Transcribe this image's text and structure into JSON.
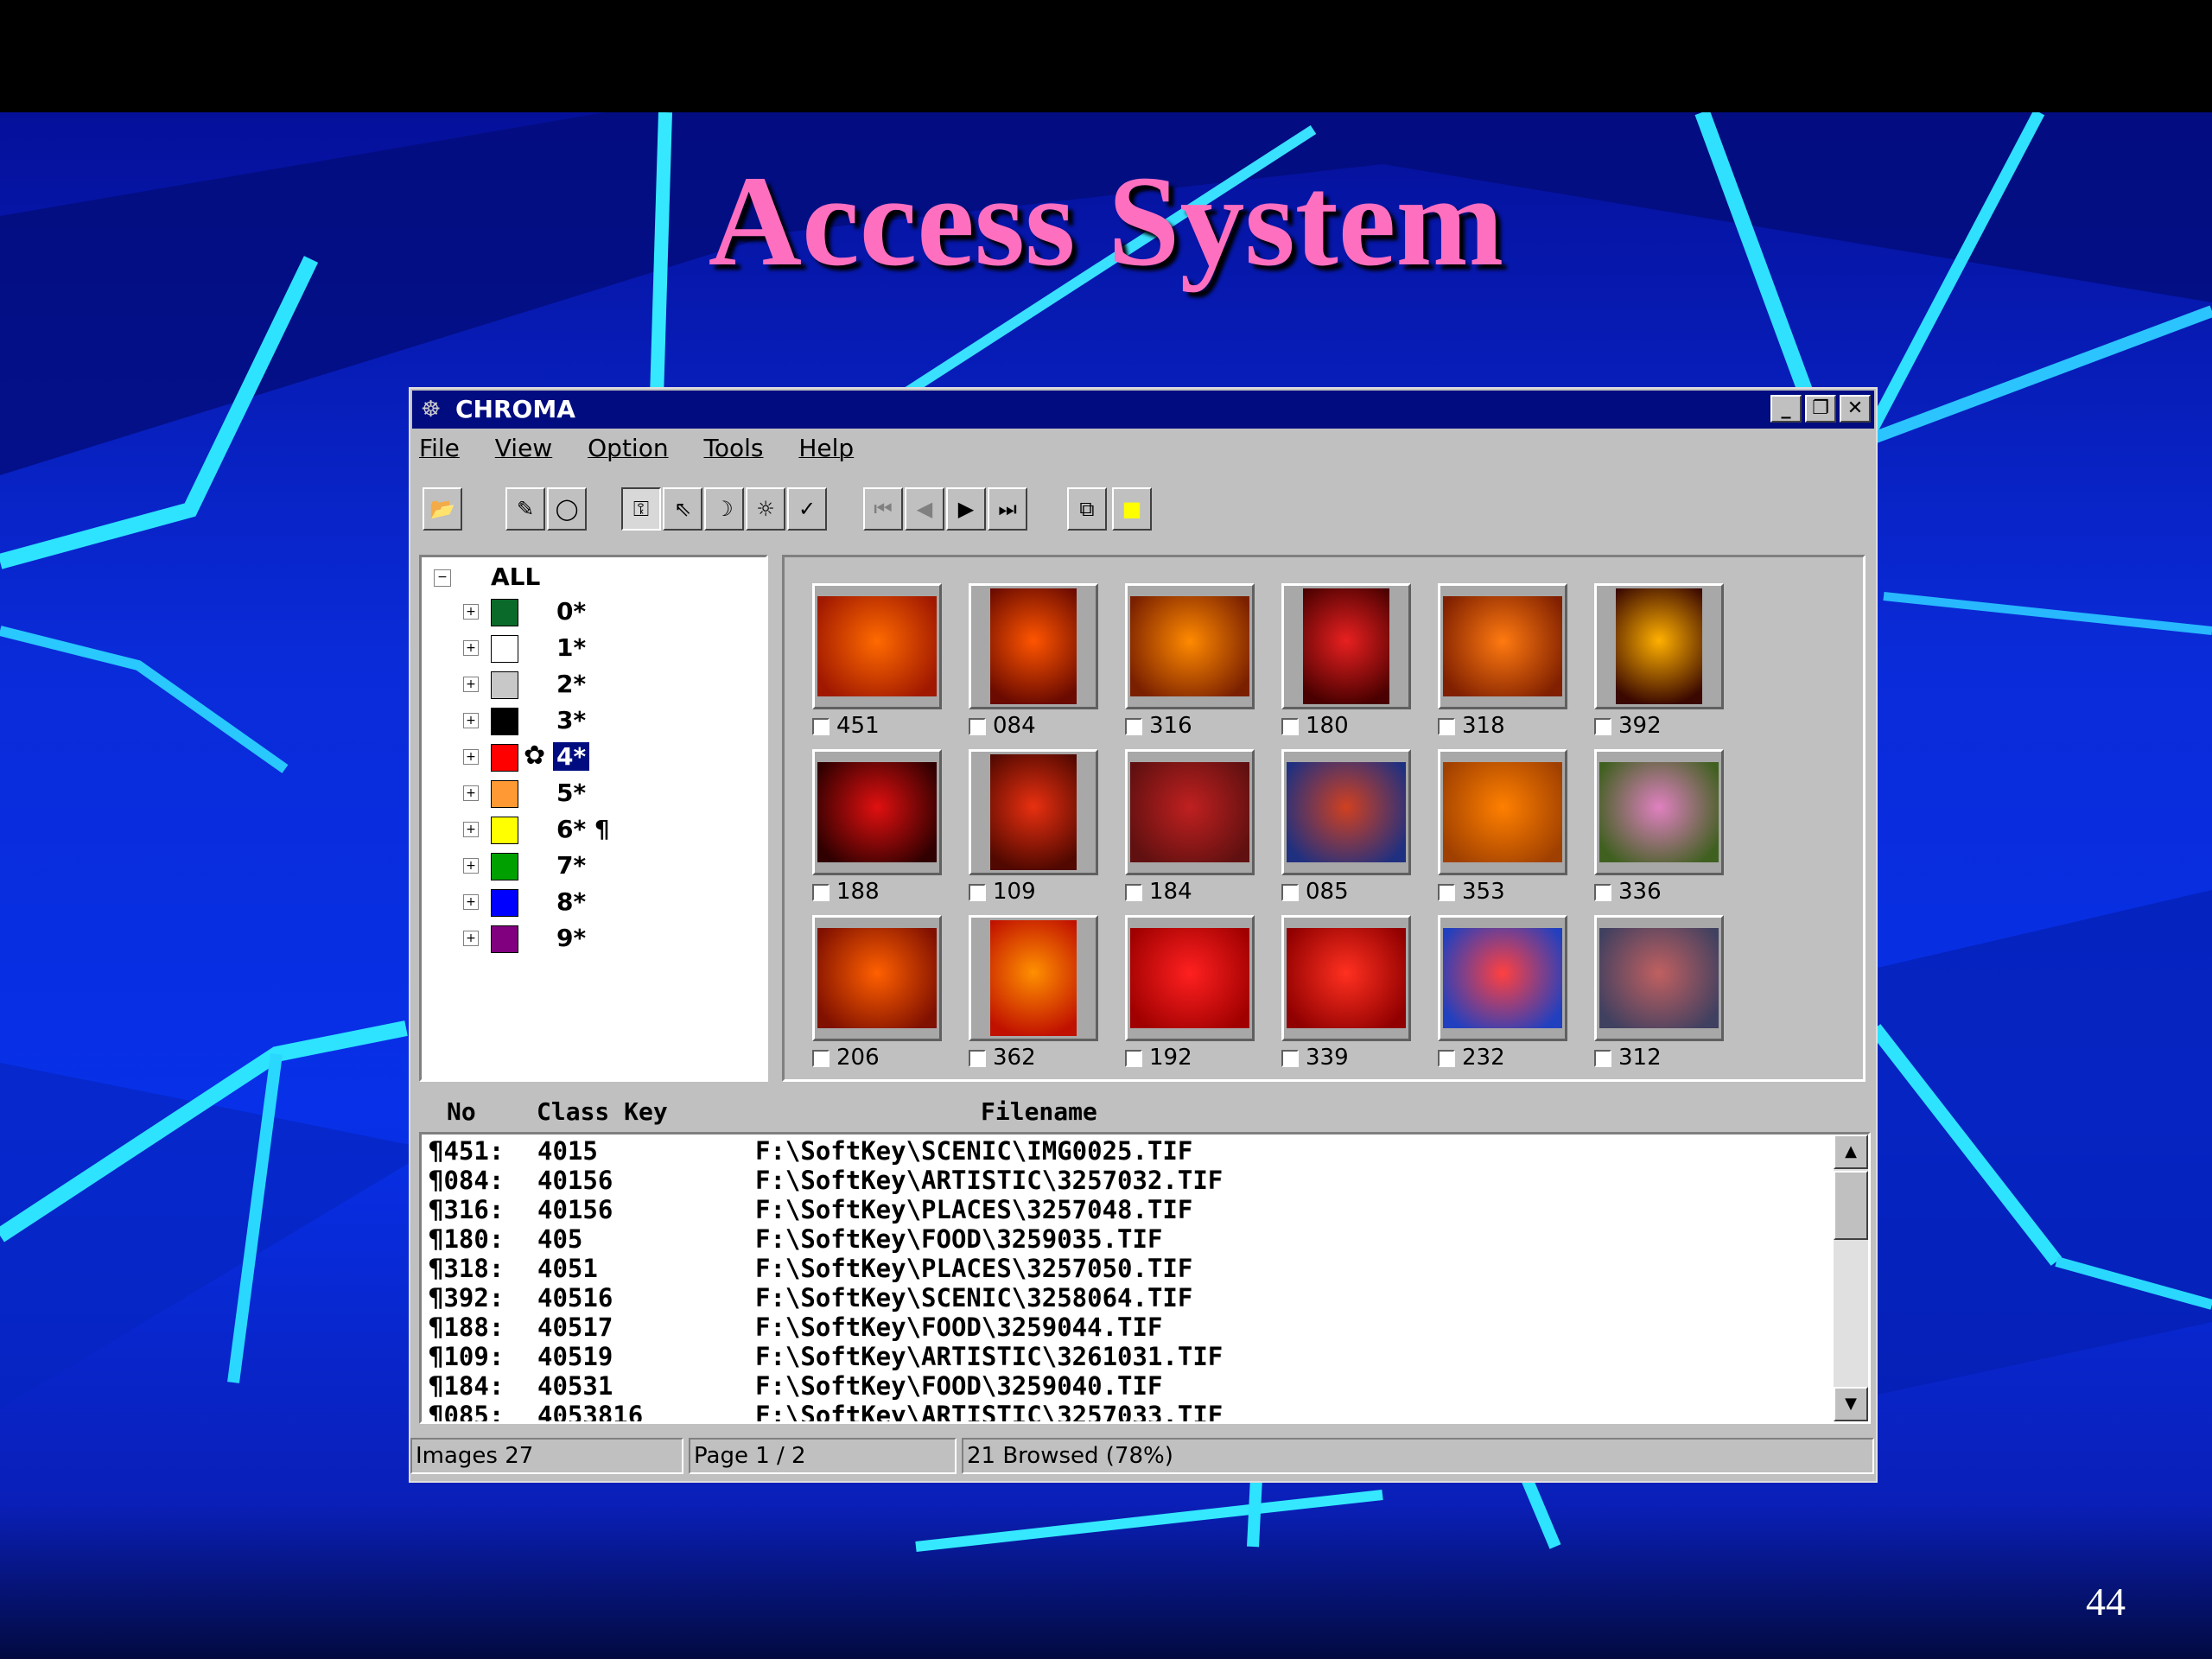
{
  "slide": {
    "title": "Access System",
    "page_number": "44",
    "colors": {
      "title": "#ff6fc0",
      "background": "#0a2bd8",
      "streaks": "#2ee3ff"
    }
  },
  "window": {
    "title": "CHROMA",
    "app_icon": "chroma-app-icon",
    "controls": {
      "minimize": "_",
      "restore": "❐",
      "close": "✕"
    },
    "titlebar_color": "#000c80"
  },
  "menu": [
    {
      "label": "File"
    },
    {
      "label": "View"
    },
    {
      "label": "Option"
    },
    {
      "label": "Tools"
    },
    {
      "label": "Help"
    }
  ],
  "toolbar": [
    {
      "icon": "open-folder-icon",
      "glyph": "📂"
    },
    {
      "icon": "pencil-icon",
      "glyph": "✎"
    },
    {
      "icon": "circle-icon",
      "glyph": "◯"
    },
    {
      "icon": "key-icon",
      "glyph": "⚿",
      "pressed": true
    },
    {
      "icon": "pointer-icon",
      "glyph": "⇖"
    },
    {
      "icon": "moon-icon",
      "glyph": "☽"
    },
    {
      "icon": "sun-icon",
      "glyph": "☼"
    },
    {
      "icon": "check-icon",
      "glyph": "✓"
    },
    {
      "icon": "first-page-icon",
      "glyph": "⏮",
      "dim": true
    },
    {
      "icon": "previous-page-icon",
      "glyph": "◀",
      "dim": true
    },
    {
      "icon": "next-page-icon",
      "glyph": "▶"
    },
    {
      "icon": "last-page-icon",
      "glyph": "⏭"
    },
    {
      "icon": "compare-icon",
      "glyph": "⧉"
    },
    {
      "icon": "color-palette-icon",
      "glyph": "■"
    }
  ],
  "tree": {
    "root": "ALL",
    "items": [
      {
        "label": "0*",
        "color": "#0a6a2a"
      },
      {
        "label": "1*",
        "color": "#ffffff"
      },
      {
        "label": "2*",
        "color": "#c8c8c8"
      },
      {
        "label": "3*",
        "color": "#000000"
      },
      {
        "label": "4*",
        "color": "#ff0000",
        "selected": true
      },
      {
        "label": "5*",
        "color": "#ff9933"
      },
      {
        "label": "6* ¶",
        "color": "#ffff00"
      },
      {
        "label": "7*",
        "color": "#00a000"
      },
      {
        "label": "8*",
        "color": "#0000ff"
      },
      {
        "label": "9*",
        "color": "#800080"
      }
    ]
  },
  "thumbnails": [
    {
      "caption": "451",
      "colors": [
        "#ff6a00",
        "#a01800"
      ],
      "tall": false
    },
    {
      "caption": "084",
      "colors": [
        "#ff5500",
        "#6a0a00"
      ],
      "tall": true
    },
    {
      "caption": "316",
      "colors": [
        "#ff8a00",
        "#7a2000"
      ],
      "tall": false
    },
    {
      "caption": "180",
      "colors": [
        "#e82020",
        "#4a0000"
      ],
      "tall": true
    },
    {
      "caption": "318",
      "colors": [
        "#ff7a10",
        "#802000"
      ],
      "tall": false
    },
    {
      "caption": "392",
      "colors": [
        "#ffb000",
        "#3a0800"
      ],
      "tall": true
    },
    {
      "caption": "188",
      "colors": [
        "#e01010",
        "#300000"
      ],
      "tall": false
    },
    {
      "caption": "109",
      "colors": [
        "#e83010",
        "#500800"
      ],
      "tall": true
    },
    {
      "caption": "184",
      "colors": [
        "#c02020",
        "#601010"
      ],
      "tall": false
    },
    {
      "caption": "085",
      "colors": [
        "#d04020",
        "#203080"
      ],
      "tall": false
    },
    {
      "caption": "353",
      "colors": [
        "#ff8000",
        "#a04000"
      ],
      "tall": false
    },
    {
      "caption": "336",
      "colors": [
        "#e080c0",
        "#406020"
      ],
      "tall": false
    },
    {
      "caption": "206",
      "colors": [
        "#ff6000",
        "#801000"
      ],
      "tall": false
    },
    {
      "caption": "362",
      "colors": [
        "#ff9000",
        "#c01000"
      ],
      "tall": true
    },
    {
      "caption": "192",
      "colors": [
        "#ff2020",
        "#a00000"
      ],
      "tall": false
    },
    {
      "caption": "339",
      "colors": [
        "#ff3020",
        "#900000"
      ],
      "tall": false
    },
    {
      "caption": "232",
      "colors": [
        "#ff4040",
        "#2040c0"
      ],
      "tall": false
    },
    {
      "caption": "312",
      "colors": [
        "#c06060",
        "#404060"
      ],
      "tall": false
    }
  ],
  "list": {
    "headers": {
      "no": "No",
      "class_key": "Class Key",
      "filename": "Filename"
    },
    "rows": [
      {
        "no": "¶451:",
        "key": "4015",
        "file": "F:\\SoftKey\\SCENIC\\IMG0025.TIF"
      },
      {
        "no": "¶084:",
        "key": "40156",
        "file": "F:\\SoftKey\\ARTISTIC\\3257032.TIF"
      },
      {
        "no": "¶316:",
        "key": "40156",
        "file": "F:\\SoftKey\\PLACES\\3257048.TIF"
      },
      {
        "no": "¶180:",
        "key": "405",
        "file": "F:\\SoftKey\\FOOD\\3259035.TIF"
      },
      {
        "no": "¶318:",
        "key": "4051",
        "file": "F:\\SoftKey\\PLACES\\3257050.TIF"
      },
      {
        "no": "¶392:",
        "key": "40516",
        "file": "F:\\SoftKey\\SCENIC\\3258064.TIF"
      },
      {
        "no": "¶188:",
        "key": "40517",
        "file": "F:\\SoftKey\\FOOD\\3259044.TIF"
      },
      {
        "no": "¶109:",
        "key": "40519",
        "file": "F:\\SoftKey\\ARTISTIC\\3261031.TIF"
      },
      {
        "no": "¶184:",
        "key": "40531",
        "file": "F:\\SoftKey\\FOOD\\3259040.TIF"
      },
      {
        "no": "¶085:",
        "key": "4053816",
        "file": "F:\\SoftKey\\ARTISTIC\\3257033.TIF"
      }
    ]
  },
  "status": {
    "images": "Images 27",
    "page": "Page 1 / 2",
    "browsed": "21 Browsed (78%)"
  }
}
